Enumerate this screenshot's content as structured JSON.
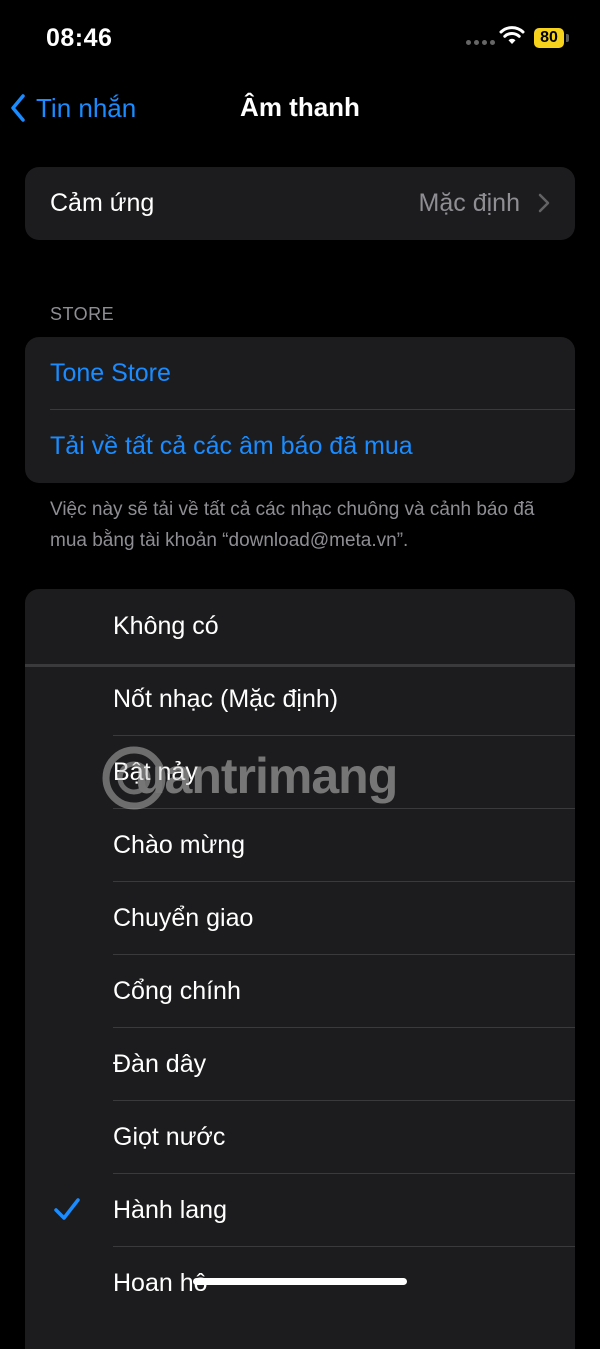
{
  "status": {
    "time": "08:46",
    "battery": "80"
  },
  "nav": {
    "back_label": "Tin nhắn",
    "title": "Âm thanh"
  },
  "haptics": {
    "label": "Cảm ứng",
    "value": "Mặc định"
  },
  "store": {
    "header": "STORE",
    "tone_store": "Tone Store",
    "download_all": "Tải về tất cả các âm báo đã mua",
    "footer": "Việc này sẽ tải về tất cả các nhạc chuông và cảnh báo đã mua bằng tài khoản “download@meta.vn”."
  },
  "tones": {
    "none": "Không có",
    "items": [
      "Nốt nhạc (Mặc định)",
      "Bật nảy",
      "Chào mừng",
      "Chuyển giao",
      "Cổng chính",
      "Đàn dây",
      "Giọt nước",
      "Hành lang",
      "Hoan hô"
    ],
    "selected": "Hành lang"
  },
  "watermark": "uantrimang",
  "colors": {
    "accent": "#1a8cff",
    "background": "#000000",
    "cell": "#1c1c1e",
    "battery": "#f7d21c"
  }
}
